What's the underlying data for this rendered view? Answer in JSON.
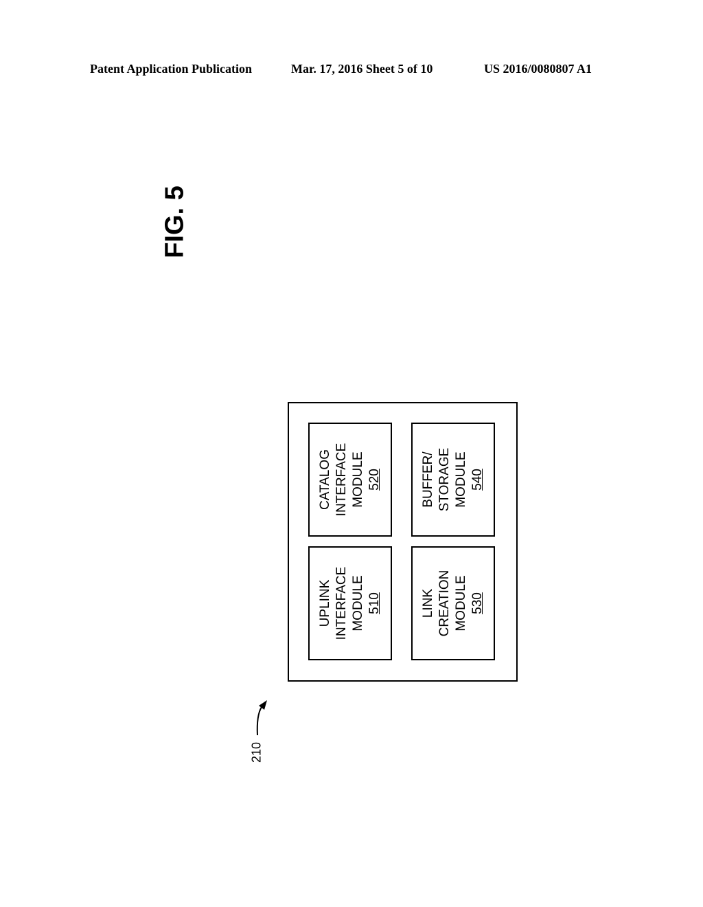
{
  "header": {
    "publication": "Patent Application Publication",
    "date_sheet": "Mar. 17, 2016  Sheet 5 of 10",
    "number": "US 2016/0080807 A1"
  },
  "figure": {
    "label": "FIG. 5",
    "reference": "210"
  },
  "modules": [
    {
      "line1": "UPLINK",
      "line2": "INTERFACE",
      "line3": "MODULE",
      "number": "510"
    },
    {
      "line1": "CATALOG",
      "line2": "INTERFACE",
      "line3": "MODULE",
      "number": "520"
    },
    {
      "line1": "LINK",
      "line2": "CREATION",
      "line3": "MODULE",
      "number": "530"
    },
    {
      "line1": "BUFFER/",
      "line2": "STORAGE",
      "line3": "MODULE",
      "number": "540"
    }
  ]
}
